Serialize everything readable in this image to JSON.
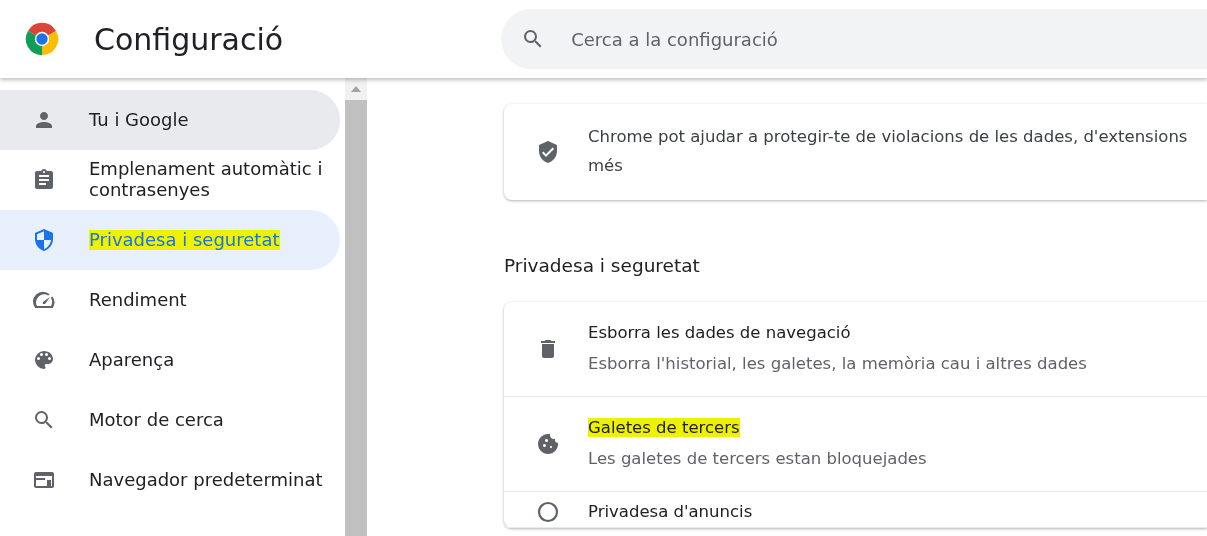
{
  "header": {
    "title": "Configuració",
    "search": {
      "placeholder": "Cerca a la configuració"
    }
  },
  "sidebar": {
    "items": [
      {
        "label": "Tu i Google",
        "selected": false,
        "hovered": true,
        "highlighted": false
      },
      {
        "label": "Emplenament automàtic i contrasenyes",
        "selected": false,
        "hovered": false,
        "highlighted": false
      },
      {
        "label": "Privadesa i seguretat",
        "selected": true,
        "hovered": false,
        "highlighted": true
      },
      {
        "label": "Rendiment",
        "selected": false,
        "hovered": false,
        "highlighted": false
      },
      {
        "label": "Aparença",
        "selected": false,
        "hovered": false,
        "highlighted": false
      },
      {
        "label": "Motor de cerca",
        "selected": false,
        "hovered": false,
        "highlighted": false
      },
      {
        "label": "Navegador predeterminat",
        "selected": false,
        "hovered": false,
        "highlighted": false
      }
    ]
  },
  "safety_card": {
    "lines": [
      "Chrome pot ajudar a protegir-te de violacions de les dades, d'extensions",
      "més"
    ]
  },
  "section": {
    "title": "Privadesa i seguretat",
    "rows": [
      {
        "title": "Esborra les dades de navegació",
        "subtitle": "Esborra l'historial, les galetes, la memòria cau i altres dades",
        "highlighted": false
      },
      {
        "title": "Galetes de tercers",
        "subtitle": "Les galetes de tercers estan bloquejades",
        "highlighted": true
      },
      {
        "title": "Privadesa d'anuncis",
        "highlighted": false
      }
    ]
  }
}
